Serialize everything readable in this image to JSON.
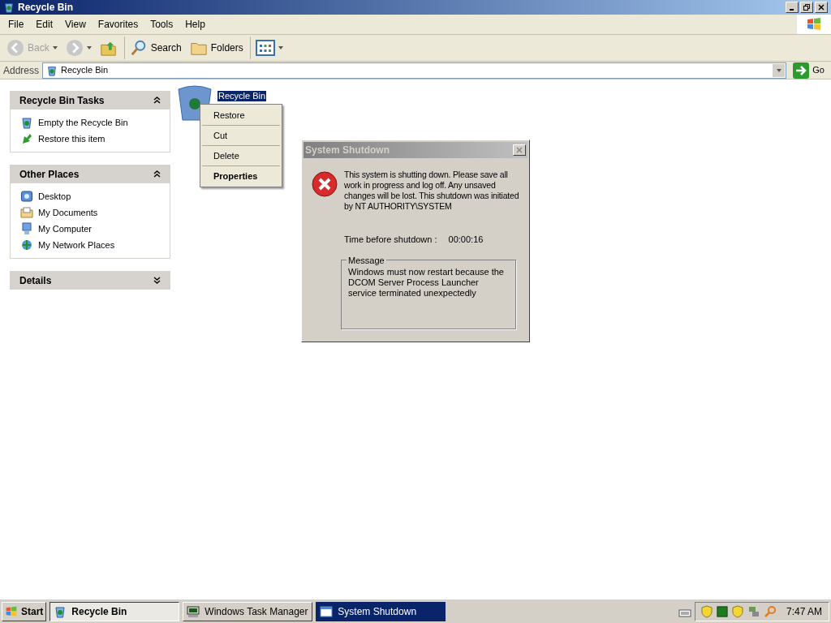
{
  "window": {
    "title": "Recycle Bin"
  },
  "menu": [
    "File",
    "Edit",
    "View",
    "Favorites",
    "Tools",
    "Help"
  ],
  "toolbar": [
    {
      "kind": "back",
      "label": "Back",
      "disabled": true
    },
    {
      "kind": "forward",
      "disabled": true
    },
    {
      "kind": "up"
    },
    {
      "kind": "search",
      "label": "Search"
    },
    {
      "kind": "folders",
      "label": "Folders"
    },
    {
      "kind": "views"
    }
  ],
  "address": {
    "label": "Address",
    "value": "Recycle Bin",
    "go": "Go"
  },
  "panels": [
    {
      "title": "Recycle Bin Tasks",
      "expanded": true,
      "items": [
        {
          "kind": "empty",
          "label": "Empty the Recycle Bin"
        },
        {
          "kind": "restore",
          "label": "Restore this item"
        }
      ]
    },
    {
      "title": "Other Places",
      "expanded": true,
      "items": [
        {
          "kind": "desktop",
          "label": "Desktop"
        },
        {
          "kind": "documents",
          "label": "My Documents"
        },
        {
          "kind": "computer",
          "label": "My Computer"
        },
        {
          "kind": "network",
          "label": "My Network Places"
        }
      ]
    },
    {
      "title": "Details",
      "expanded": false
    }
  ],
  "file_item": {
    "label": "Recycle Bin",
    "selected": true
  },
  "context_menu": [
    {
      "label": "Restore",
      "default": false
    },
    {
      "label": "Cut",
      "default": false
    },
    {
      "label": "Delete",
      "default": false
    },
    {
      "label": "Properties",
      "default": true
    }
  ],
  "dialog": {
    "title": "System Shutdown",
    "text": "This system is shutting down. Please save all work in progress and log off. Any unsaved changes will be lost. This shutdown was initiated by NT AUTHORITY\\SYSTEM",
    "time_label": "Time before shutdown :",
    "time_value": "00:00:16",
    "message_label": "Message",
    "message": "Windows must now restart because the DCOM Server Process Launcher service terminated unexpectedly"
  },
  "taskbar": {
    "start": "Start",
    "tasks": [
      {
        "kind": "recycle",
        "label": "Recycle Bin",
        "pressed": true,
        "selected": false
      },
      {
        "kind": "taskmgr",
        "label": "Windows Task Manager",
        "pressed": false,
        "selected": false
      },
      {
        "kind": "window",
        "label": "System Shutdown",
        "pressed": false,
        "selected": true
      }
    ],
    "clock": "7:47 AM"
  }
}
